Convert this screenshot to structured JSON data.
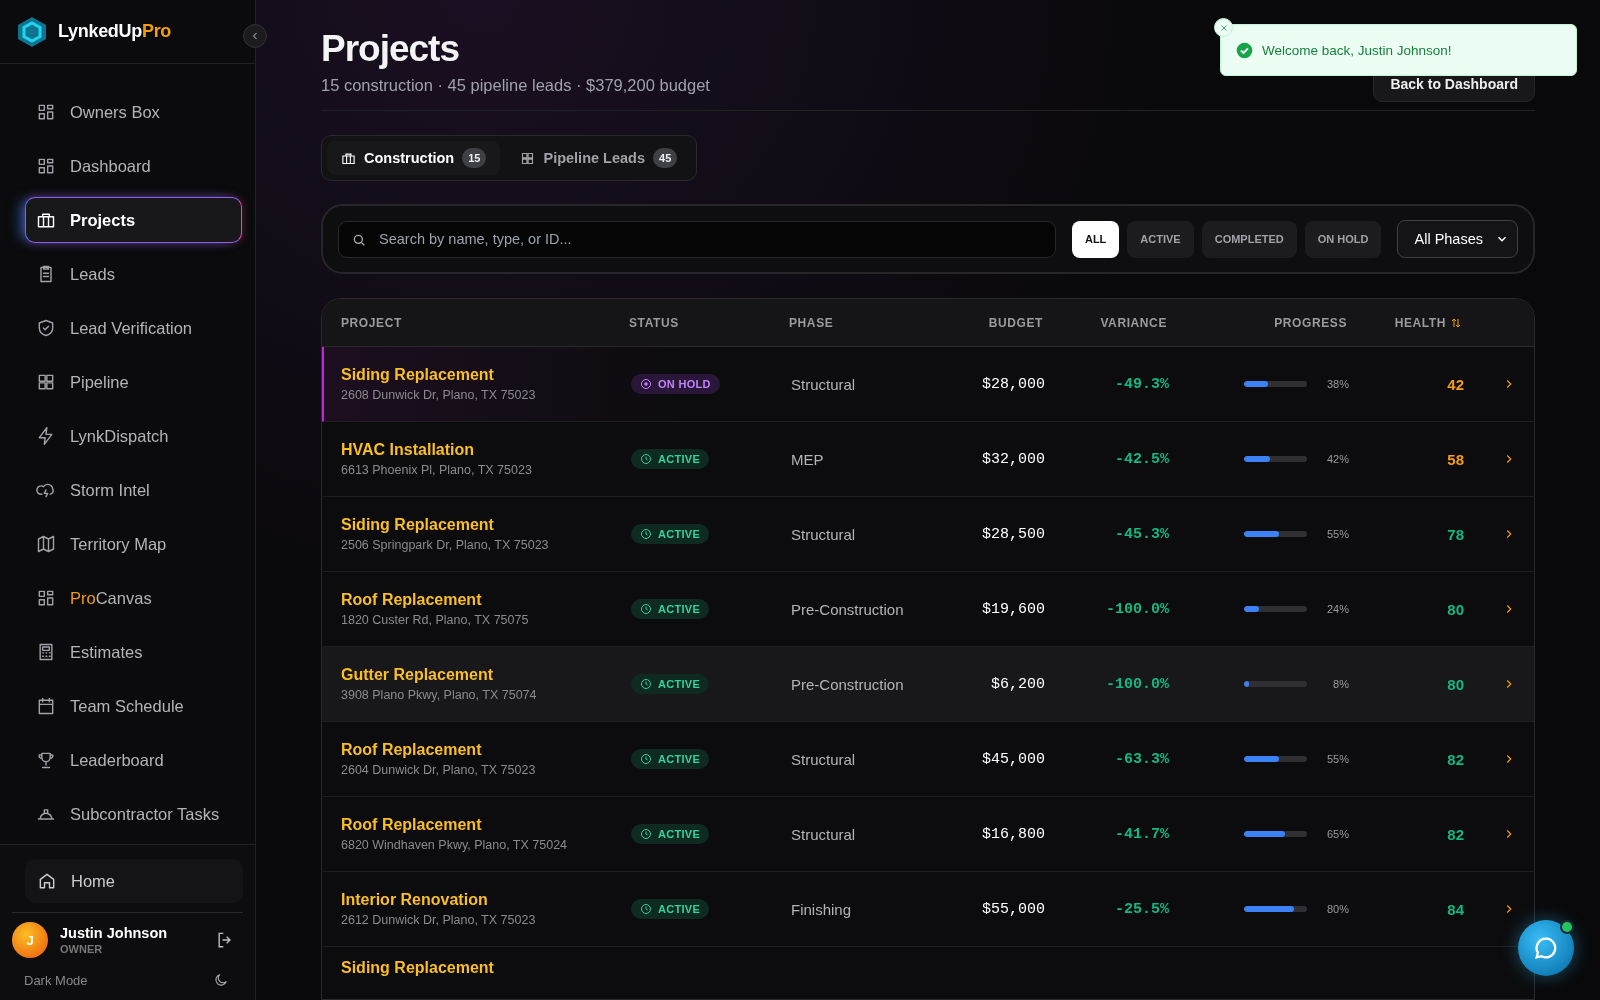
{
  "brand": {
    "name": "LynkedUp",
    "accent": "Pro"
  },
  "sidebar": {
    "items": [
      {
        "label": "Owners Box",
        "selected": false
      },
      {
        "label": "Dashboard",
        "selected": false
      },
      {
        "label": "Projects",
        "selected": true
      },
      {
        "label": "Leads",
        "selected": false
      },
      {
        "label": "Lead Verification",
        "selected": false
      },
      {
        "label": "Pipeline",
        "selected": false
      },
      {
        "label": "LynkDispatch",
        "selected": false
      },
      {
        "label": "Storm Intel",
        "selected": false
      },
      {
        "label": "Territory Map",
        "selected": false
      },
      {
        "accent": "Pro",
        "label": "Canvas",
        "selected": false
      },
      {
        "label": "Estimates",
        "selected": false
      },
      {
        "label": "Team Schedule",
        "selected": false
      },
      {
        "label": "Leaderboard",
        "selected": false
      },
      {
        "label": "Subcontractor Tasks",
        "selected": false
      }
    ],
    "home": "Home",
    "user": {
      "initial": "J",
      "name": "Justin Johnson",
      "role": "OWNER"
    },
    "theme": "Dark Mode"
  },
  "header": {
    "title": "Projects",
    "subtitle": "15 construction · 45 pipeline leads · $379,200 budget",
    "back_button": "Back to Dashboard"
  },
  "toast": {
    "message": "Welcome back, Justin Johnson!"
  },
  "tabs": [
    {
      "label": "Construction",
      "count": "15",
      "selected": true
    },
    {
      "label": "Pipeline Leads",
      "count": "45",
      "selected": false
    }
  ],
  "search": {
    "placeholder": "Search by name, type, or ID..."
  },
  "filters": [
    {
      "label": "ALL",
      "selected": true
    },
    {
      "label": "ACTIVE",
      "selected": false
    },
    {
      "label": "COMPLETED",
      "selected": false
    },
    {
      "label": "ON HOLD",
      "selected": false
    }
  ],
  "phase_select": "All Phases",
  "table": {
    "columns": [
      "PROJECT",
      "STATUS",
      "PHASE",
      "BUDGET",
      "VARIANCE",
      "PROGRESS",
      "HEALTH"
    ],
    "rows": [
      {
        "name": "Siding Replacement",
        "address": "2608 Dunwick Dr, Plano, TX 75023",
        "status": {
          "kind": "on_hold",
          "label": "ON HOLD"
        },
        "phase": "Structural",
        "budget": "$28,000",
        "variance": "-49.3%",
        "level": 0.38,
        "progress": "38%",
        "health": {
          "value": "42",
          "color": "#f59e0b"
        },
        "selected": false
      },
      {
        "name": "HVAC Installation",
        "address": "6613 Phoenix Pl, Plano, TX 75023",
        "status": {
          "kind": "active",
          "label": "ACTIVE"
        },
        "phase": "MEP",
        "budget": "$32,000",
        "variance": "-42.5%",
        "level": 0.42,
        "progress": "42%",
        "health": {
          "value": "58",
          "color": "#f59e0b"
        },
        "selected": false
      },
      {
        "name": "Siding Replacement",
        "address": "2506 Springpark Dr, Plano, TX 75023",
        "status": {
          "kind": "active",
          "label": "ACTIVE"
        },
        "phase": "Structural",
        "budget": "$28,500",
        "variance": "-45.3%",
        "level": 0.55,
        "progress": "55%",
        "health": {
          "value": "78",
          "color": "#10b981"
        },
        "selected": false
      },
      {
        "name": "Roof Replacement",
        "address": "1820 Custer Rd, Plano, TX 75075",
        "status": {
          "kind": "active",
          "label": "ACTIVE"
        },
        "phase": "Pre-Construction",
        "budget": "$19,600",
        "variance": "-100.0%",
        "level": 0.24,
        "progress": "24%",
        "health": {
          "value": "80",
          "color": "#10b981"
        },
        "selected": false
      },
      {
        "name": "Gutter Replacement",
        "address": "3908 Plano Pkwy, Plano, TX 75074",
        "status": {
          "kind": "active",
          "label": "ACTIVE"
        },
        "phase": "Pre-Construction",
        "budget": "$6,200",
        "variance": "-100.0%",
        "level": 0.08,
        "progress": "8%",
        "health": {
          "value": "80",
          "color": "#10b981"
        },
        "selected": true
      },
      {
        "name": "Roof Replacement",
        "address": "2604 Dunwick Dr, Plano, TX 75023",
        "status": {
          "kind": "active",
          "label": "ACTIVE"
        },
        "phase": "Structural",
        "budget": "$45,000",
        "variance": "-63.3%",
        "level": 0.55,
        "progress": "55%",
        "health": {
          "value": "82",
          "color": "#10b981"
        },
        "selected": false
      },
      {
        "name": "Roof Replacement",
        "address": "6820 Windhaven Pkwy, Plano, TX 75024",
        "status": {
          "kind": "active",
          "label": "ACTIVE"
        },
        "phase": "Structural",
        "budget": "$16,800",
        "variance": "-41.7%",
        "level": 0.65,
        "progress": "65%",
        "health": {
          "value": "82",
          "color": "#10b981"
        },
        "selected": false
      },
      {
        "name": "Interior Renovation",
        "address": "2612 Dunwick Dr, Plano, TX 75023",
        "status": {
          "kind": "active",
          "label": "ACTIVE"
        },
        "phase": "Finishing",
        "budget": "$55,000",
        "variance": "-25.5%",
        "level": 0.8,
        "progress": "80%",
        "health": {
          "value": "84",
          "color": "#10b981"
        },
        "selected": false
      }
    ],
    "partial_row": {
      "name": "Siding Replacement"
    }
  }
}
